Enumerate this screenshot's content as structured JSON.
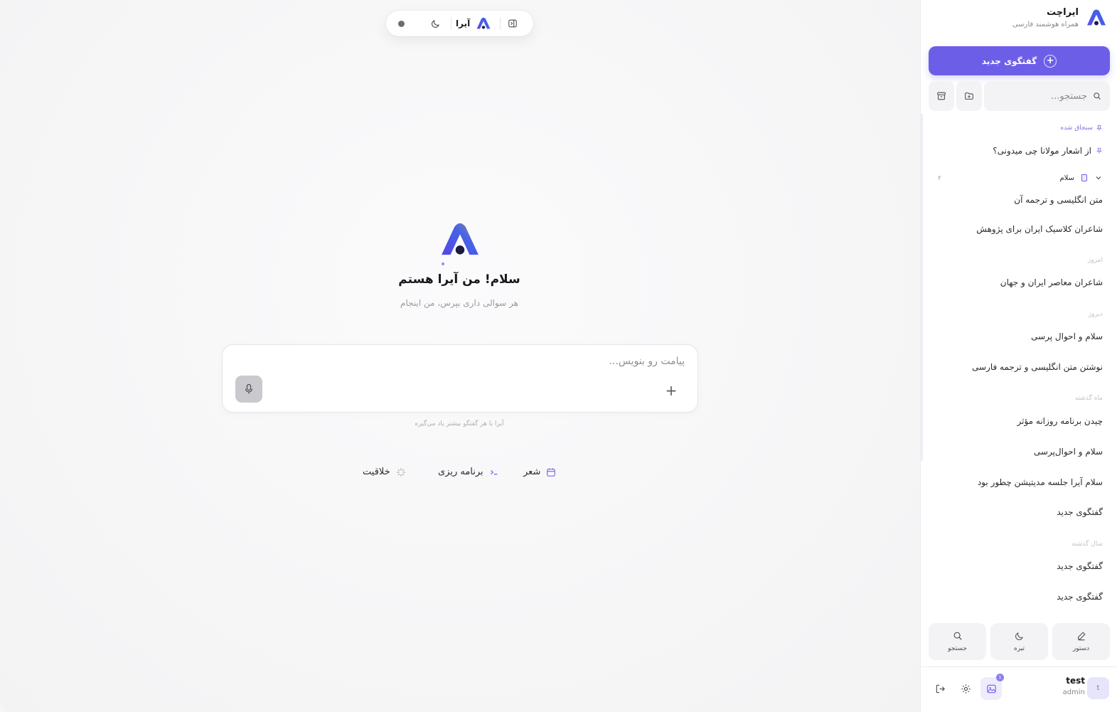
{
  "topbar": {
    "brand": "آیرا"
  },
  "hero": {
    "title": "سلام! من آیرا هستم",
    "subtitle": "هر سوالی داری بپرس، من اینجام"
  },
  "composer": {
    "placeholder": "پیامت رو بنویس...",
    "plus": "+",
    "hint": "آیرا با هر گفتگو بیشتر یاد می‌گیره"
  },
  "chips": [
    {
      "label": "شعر",
      "icon": "calendar-icon"
    },
    {
      "label": "برنامه ریزی",
      "icon": "terminal-icon"
    },
    {
      "label": "خلاقیت",
      "icon": "sparkle-icon"
    }
  ],
  "sidebar": {
    "app_name": "ایراچت",
    "tagline": "همراه هوشمند فارسی",
    "new_chat": "گفتگوی جدید",
    "search_placeholder": "جستجو...",
    "pinned_label": "سنجاق شده",
    "pinned_item": "از اشعار مولانا چی میدونی؟",
    "folder": {
      "name": "سلام",
      "count": "۲"
    },
    "folder_items": [
      "متن انگلیسی و ترجمه آن",
      "شاعران کلاسیک ایران برای پژوهش"
    ],
    "sections": [
      {
        "label": "امروز",
        "items": [
          "شاعران معاصر ایران و جهان"
        ]
      },
      {
        "label": "دیروز",
        "items": [
          "سلام و احوال پرسی",
          "نوشتن متن انگلیسی و ترجمه فارسی"
        ]
      },
      {
        "label": "ماه گذشته",
        "items": [
          "چیدن برنامه روزانه مؤثر",
          "سلام و احوال‌پرسی",
          "سلام آیرا جلسه مدیتیشن چطور بود",
          "گفتگوی جدید"
        ]
      },
      {
        "label": "سال گذشته",
        "items": [
          "گفتگوی جدید",
          "گفتگوی جدید"
        ]
      }
    ],
    "tools": [
      "دستور",
      "تیره",
      "جستجو"
    ],
    "user": {
      "name": "test",
      "role": "admin",
      "initial": "t",
      "notifications": "1"
    }
  },
  "colors": {
    "accent": "#6d5ee8",
    "accent_soft": "#e7e5fb",
    "background": "#f7f7f8"
  }
}
